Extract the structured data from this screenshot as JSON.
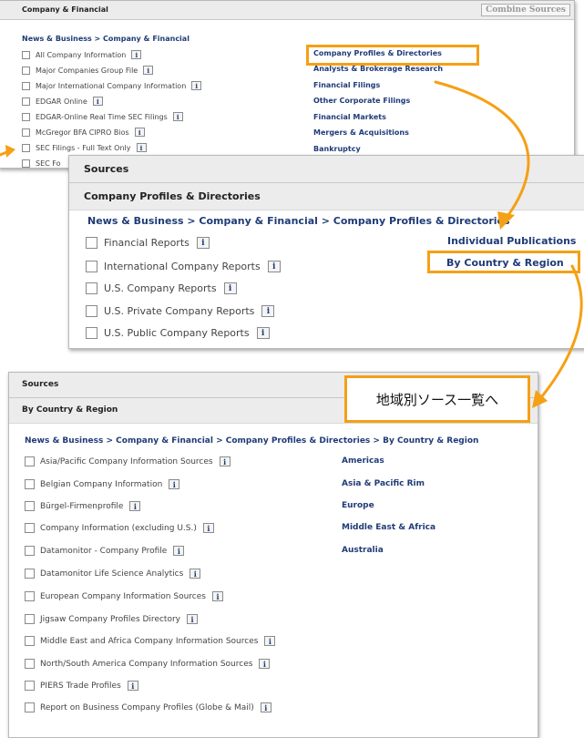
{
  "panel1": {
    "title": "Company & Financial",
    "combine_label": "Combine Sources",
    "breadcrumb": "News & Business > Company & Financial",
    "items": [
      "All Company Information",
      "Major Companies Group File",
      "Major International Company Information",
      "EDGAR Online",
      "EDGAR-Online Real Time SEC Filings",
      "McGregor BFA CIPRO Bios",
      "SEC Filings - Full Text Only",
      "SEC Fo"
    ],
    "categories": [
      "Company Profiles & Directories",
      "Analysts & Brokerage Research",
      "Financial Filings",
      "Other Corporate Filings",
      "Financial Markets",
      "Mergers & Acquisitions",
      "Bankruptcy"
    ]
  },
  "panel2": {
    "title": "Sources",
    "subtitle": "Company Profiles & Directories",
    "breadcrumb": "News & Business > Company & Financial > Company Profiles & Directories",
    "items": [
      "Financial Reports",
      "International Company Reports",
      "U.S. Company Reports",
      "U.S. Private Company Reports",
      "U.S. Public Company Reports"
    ],
    "links": [
      "Individual Publications",
      "By Country & Region"
    ]
  },
  "panel3": {
    "title": "Sources",
    "subtitle": "By Country & Region",
    "breadcrumb": "News & Business > Company & Financial > Company Profiles & Directories > By Country & Region",
    "items": [
      "Asia/Pacific Company Information Sources",
      "Belgian Company Information",
      "Bürgel-Firmenprofile",
      "Company Information (excluding U.S.)",
      "Datamonitor - Company Profile",
      "Datamonitor Life Science Analytics",
      "European Company Information Sources",
      "Jigsaw Company Profiles Directory",
      "Middle East and Africa Company Information Sources",
      "North/South America Company Information Sources",
      "PIERS Trade Profiles",
      "Report on Business Company Profiles (Globe & Mail)"
    ],
    "regions": [
      "Americas",
      "Asia & Pacific Rim",
      "Europe",
      "Middle East & Africa",
      "Australia"
    ]
  },
  "callout": {
    "text": "地域別ソース一覧へ"
  },
  "info_glyph": "i",
  "colors": {
    "highlight": "#f5a015",
    "link": "#1f3b77",
    "header_bg": "#ececec"
  }
}
